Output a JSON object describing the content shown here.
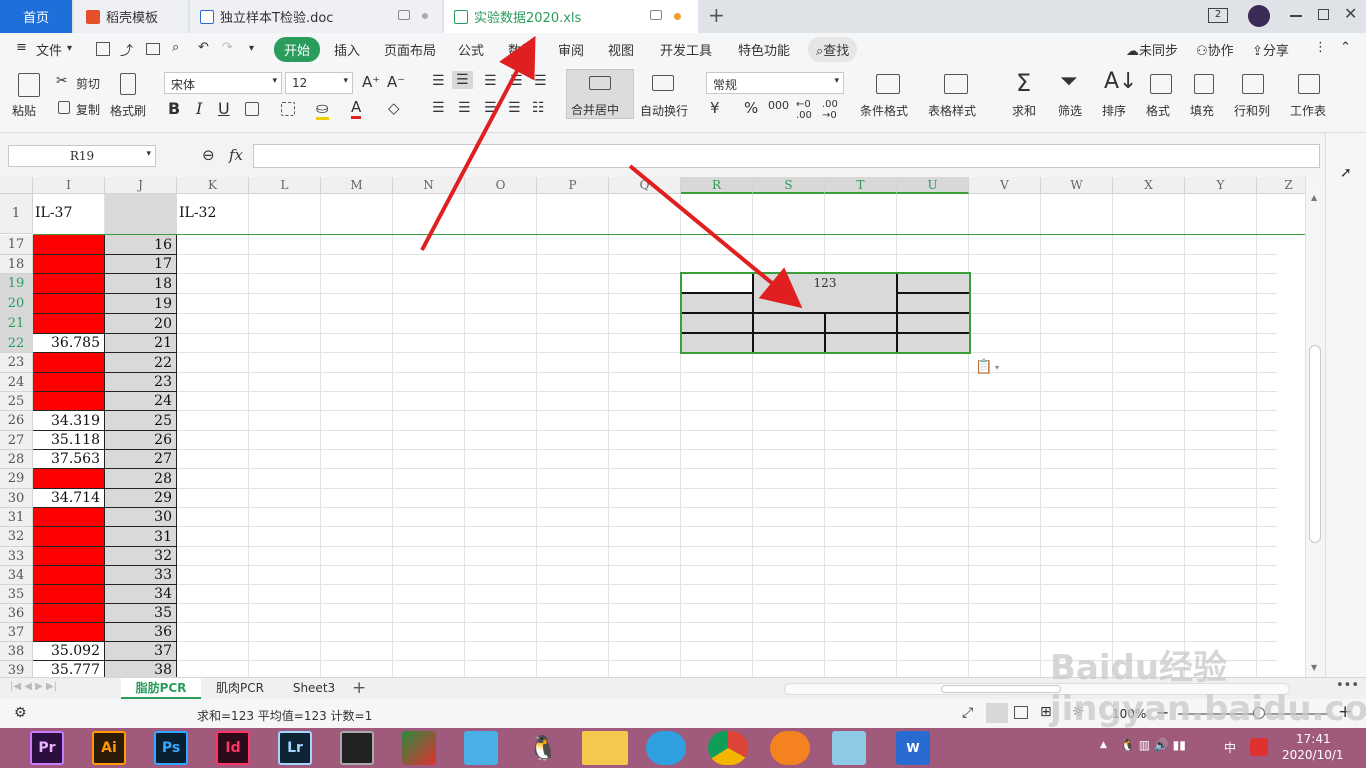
{
  "tabs": {
    "home": "首页",
    "daoke": "稻壳模板",
    "doc": "独立样本T检验.doc",
    "xls": "实验数据2020.xls",
    "badge": "2"
  },
  "menu": {
    "file": "文件",
    "items": [
      "开始",
      "插入",
      "页面布局",
      "公式",
      "数据",
      "审阅",
      "视图",
      "开发工具",
      "特色功能"
    ],
    "search": "查找",
    "sync": "未同步",
    "collab": "协作",
    "share": "分享"
  },
  "ribbon": {
    "paste": "粘贴",
    "cut": "剪切",
    "copy": "复制",
    "format_painter": "格式刷",
    "font_name": "宋体",
    "font_size": "12",
    "merge_center": "合并居中",
    "wrap": "自动换行",
    "number_format": "常规",
    "conditional": "条件格式",
    "table_style": "表格样式",
    "sum": "求和",
    "filter": "筛选",
    "sort": "排序",
    "format": "格式",
    "fill": "填充",
    "rowcol": "行和列",
    "worksheet": "工作表"
  },
  "formula": {
    "name_box": "R19",
    "fx": "fx",
    "content": ""
  },
  "grid": {
    "columns": [
      "I",
      "J",
      "K",
      "L",
      "M",
      "N",
      "O",
      "P",
      "Q",
      "R",
      "S",
      "T",
      "U",
      "V",
      "W",
      "X",
      "Y",
      "Z"
    ],
    "row1": {
      "num": "1",
      "I": "IL-37",
      "K": "IL-32"
    },
    "rows": [
      {
        "n": "17",
        "i": "",
        "j": "16",
        "red": true
      },
      {
        "n": "18",
        "i": "",
        "j": "17",
        "red": true
      },
      {
        "n": "19",
        "i": "",
        "j": "18",
        "red": true
      },
      {
        "n": "20",
        "i": "",
        "j": "19",
        "red": true
      },
      {
        "n": "21",
        "i": "",
        "j": "20",
        "red": true
      },
      {
        "n": "22",
        "i": "36.785",
        "j": "21",
        "red": false
      },
      {
        "n": "23",
        "i": "",
        "j": "22",
        "red": true
      },
      {
        "n": "24",
        "i": "",
        "j": "23",
        "red": true
      },
      {
        "n": "25",
        "i": "",
        "j": "24",
        "red": true
      },
      {
        "n": "26",
        "i": "34.319",
        "j": "25",
        "red": false
      },
      {
        "n": "27",
        "i": "35.118",
        "j": "26",
        "red": false
      },
      {
        "n": "28",
        "i": "37.563",
        "j": "27",
        "red": false
      },
      {
        "n": "29",
        "i": "",
        "j": "28",
        "red": true
      },
      {
        "n": "30",
        "i": "34.714",
        "j": "29",
        "red": false
      },
      {
        "n": "31",
        "i": "",
        "j": "30",
        "red": true
      },
      {
        "n": "32",
        "i": "",
        "j": "31",
        "red": true
      },
      {
        "n": "33",
        "i": "",
        "j": "32",
        "red": true
      },
      {
        "n": "34",
        "i": "",
        "j": "33",
        "red": true
      },
      {
        "n": "35",
        "i": "",
        "j": "34",
        "red": true
      },
      {
        "n": "36",
        "i": "",
        "j": "35",
        "red": true
      },
      {
        "n": "37",
        "i": "",
        "j": "36",
        "red": true
      },
      {
        "n": "38",
        "i": "35.092",
        "j": "37",
        "red": false
      },
      {
        "n": "39",
        "i": "35.777",
        "j": "38",
        "red": false
      }
    ],
    "merged_value": "123"
  },
  "sheets": [
    "脂肪PCR",
    "肌肉PCR",
    "Sheet3"
  ],
  "status": {
    "summary": "求和=123  平均值=123  计数=1",
    "zoom": "100%"
  },
  "watermark": "Baidu经验 jingyan.baidu.com",
  "clock": {
    "time": "17:41",
    "date": "2020/10/1",
    "ime": "中"
  },
  "colors": {
    "accent_green": "#2a9d5c",
    "red_fill": "#ff0000",
    "gray_fill": "#d9d9d9",
    "select_green": "#3a9e3a",
    "arrow_red": "#e02020"
  }
}
